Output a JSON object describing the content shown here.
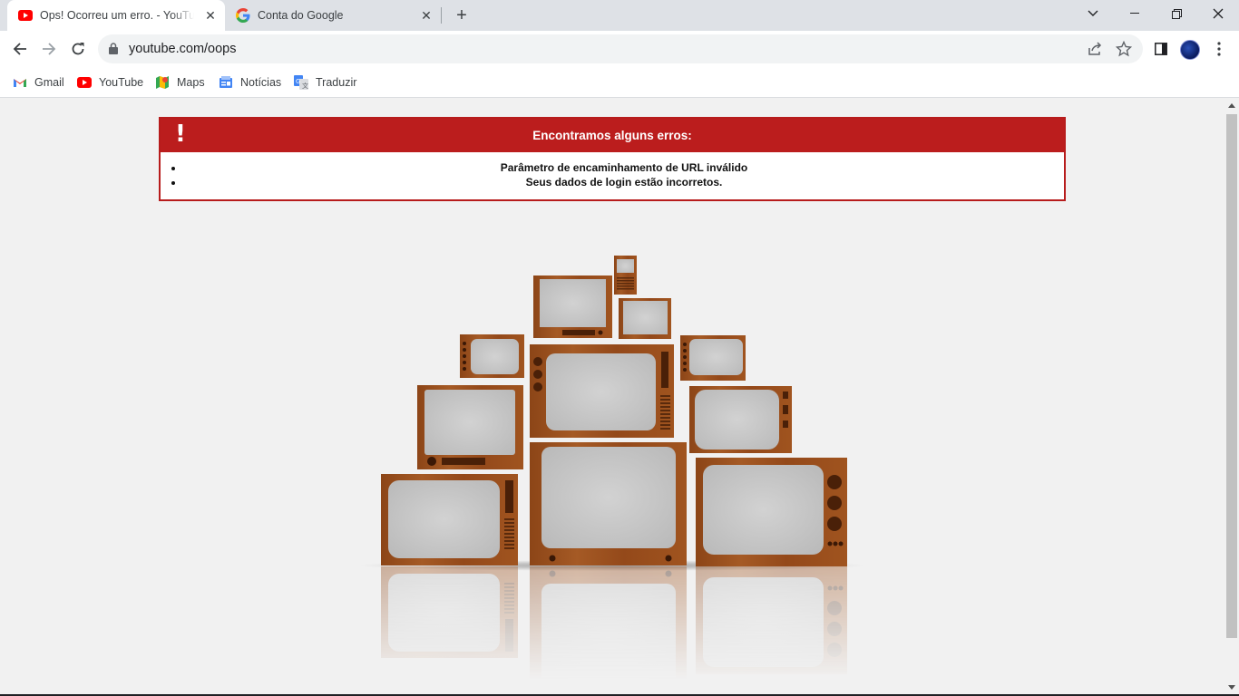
{
  "tabs": [
    {
      "title": "Ops! Ocorreu um erro. - YouTube",
      "favicon": "youtube-icon",
      "active": true
    },
    {
      "title": "Conta do Google",
      "favicon": "google-g-icon",
      "active": false
    }
  ],
  "toolbar": {
    "url": "youtube.com/oops"
  },
  "bookmarks": [
    {
      "label": "Gmail",
      "icon": "gmail-icon"
    },
    {
      "label": "YouTube",
      "icon": "youtube-icon"
    },
    {
      "label": "Maps",
      "icon": "maps-icon"
    },
    {
      "label": "Notícias",
      "icon": "news-icon"
    },
    {
      "label": "Traduzir",
      "icon": "translate-icon"
    }
  ],
  "error": {
    "title": "Encontramos alguns erros:",
    "items": [
      "Parâmetro de encaminhamento de URL inválido",
      "Seus dados de login estão incorretos."
    ]
  },
  "colors": {
    "error_red": "#bb1d1d",
    "tv_wood": "#9a4f1f",
    "screen_gray": "#c9c9c9"
  }
}
